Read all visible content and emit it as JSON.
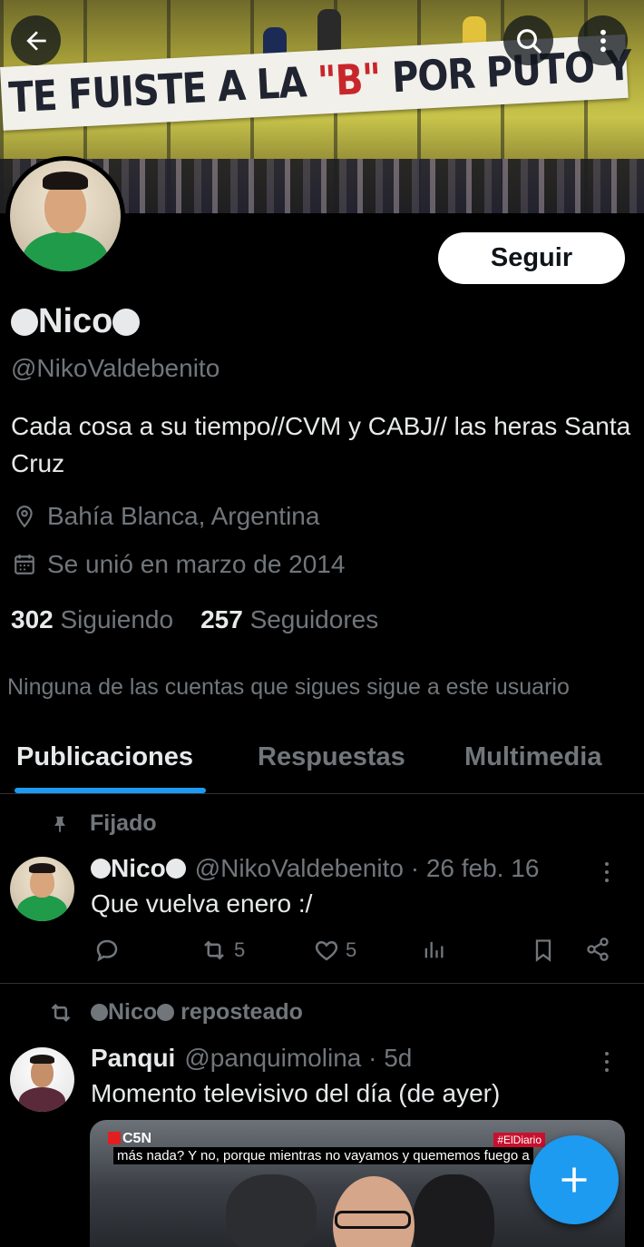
{
  "banner": {
    "banner_text_part1": "TE FUISTE A LA ",
    "banner_text_highlight": "\"B\"",
    "banner_text_part2": " POR PUTO Y CAGON"
  },
  "header": {
    "back_icon": "arrow-left-icon",
    "search_icon": "search-icon",
    "more_icon": "more-vertical-icon"
  },
  "profile": {
    "display_name": "Nico",
    "handle": "@NikoValdebenito",
    "follow_label": "Seguir",
    "bio": "Cada cosa a su tiempo//CVM y CABJ// las heras Santa Cruz",
    "location": "Bahía Blanca, Argentina",
    "joined": "Se unió en marzo de 2014",
    "following_count": "302",
    "following_label": "Siguiendo",
    "followers_count": "257",
    "followers_label": "Seguidores",
    "followed_by_note": "Ninguna de las cuentas que sigues sigue a este usuario"
  },
  "tabs": [
    {
      "label": "Publicaciones",
      "active": true
    },
    {
      "label": "Respuestas",
      "active": false
    },
    {
      "label": "Multimedia",
      "active": false
    }
  ],
  "pinned_tweet": {
    "pinned_label": "Fijado",
    "author_name": "Nico",
    "author_handle": "@NikoValdebenito",
    "date": "· 26 feb. 16",
    "text": "Que vuelva enero :/",
    "reposts": "5",
    "likes": "5"
  },
  "repost_tweet": {
    "reposted_by": "Nico",
    "reposted_label": "reposteado",
    "author_name": "Panqui",
    "author_handle": "@panquimolina",
    "date": "· 5d",
    "text": "Momento televisivo del día (de ayer)",
    "media": {
      "channel": "C5N",
      "tag": "#ElDiario",
      "caption": "más nada? Y no, porque mientras no vayamos y quememos fuego a"
    }
  },
  "colors": {
    "accent": "#1d9bf0",
    "background": "#000000",
    "secondary_text": "#71767b",
    "primary_text": "#e7e9ea"
  }
}
